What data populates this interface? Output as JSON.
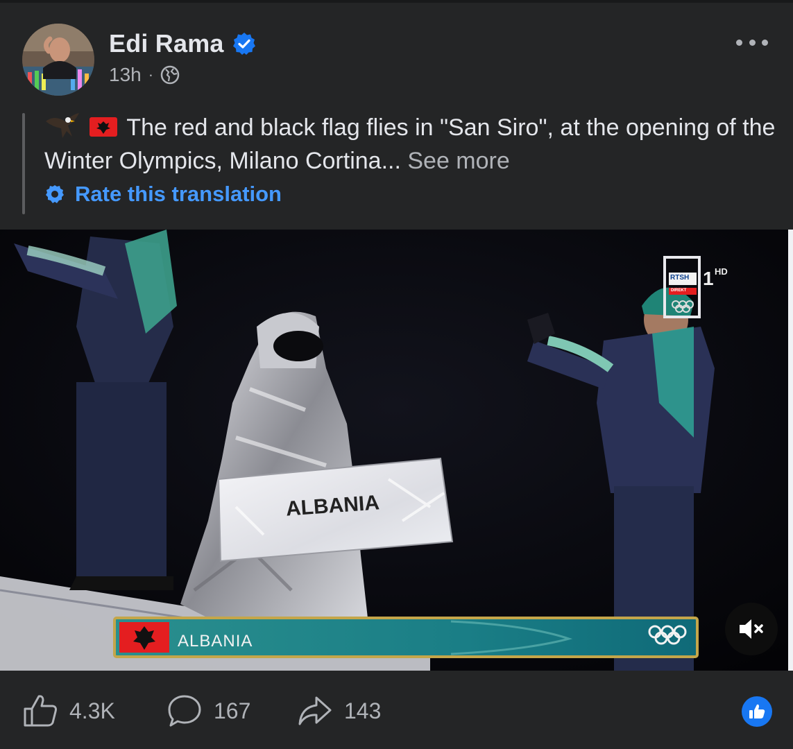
{
  "post": {
    "author": "Edi Rama",
    "time": "13h",
    "dot": "·",
    "text": "The red and black flag flies in \"San Siro\", at the opening of the Winter Olympics, Milano Cortina...",
    "see_more": "See more",
    "rate_translation": "Rate this translation"
  },
  "video": {
    "sign_text": "ALBANIA",
    "banner_text": "ALBANIA",
    "channel_logo": "RTSH",
    "channel_number": "1",
    "channel_hd": "HD",
    "channel_direkt": "DIREKT",
    "muted": true
  },
  "actions": {
    "likes": "4.3K",
    "comments": "167",
    "shares": "143"
  },
  "icons": {
    "verified": "verified-badge-icon",
    "privacy": "globe-icon",
    "more": "more-options-icon",
    "rate": "gear-icon",
    "like": "thumbs-up-icon",
    "comment": "comment-bubble-icon",
    "share": "share-arrow-icon",
    "mute": "speaker-muted-icon"
  },
  "colors": {
    "background": "#242526",
    "link_blue": "#4599ff",
    "verified_blue": "#1877f2",
    "albania_red": "#e41e20",
    "banner_teal": "#1f8d8f"
  }
}
